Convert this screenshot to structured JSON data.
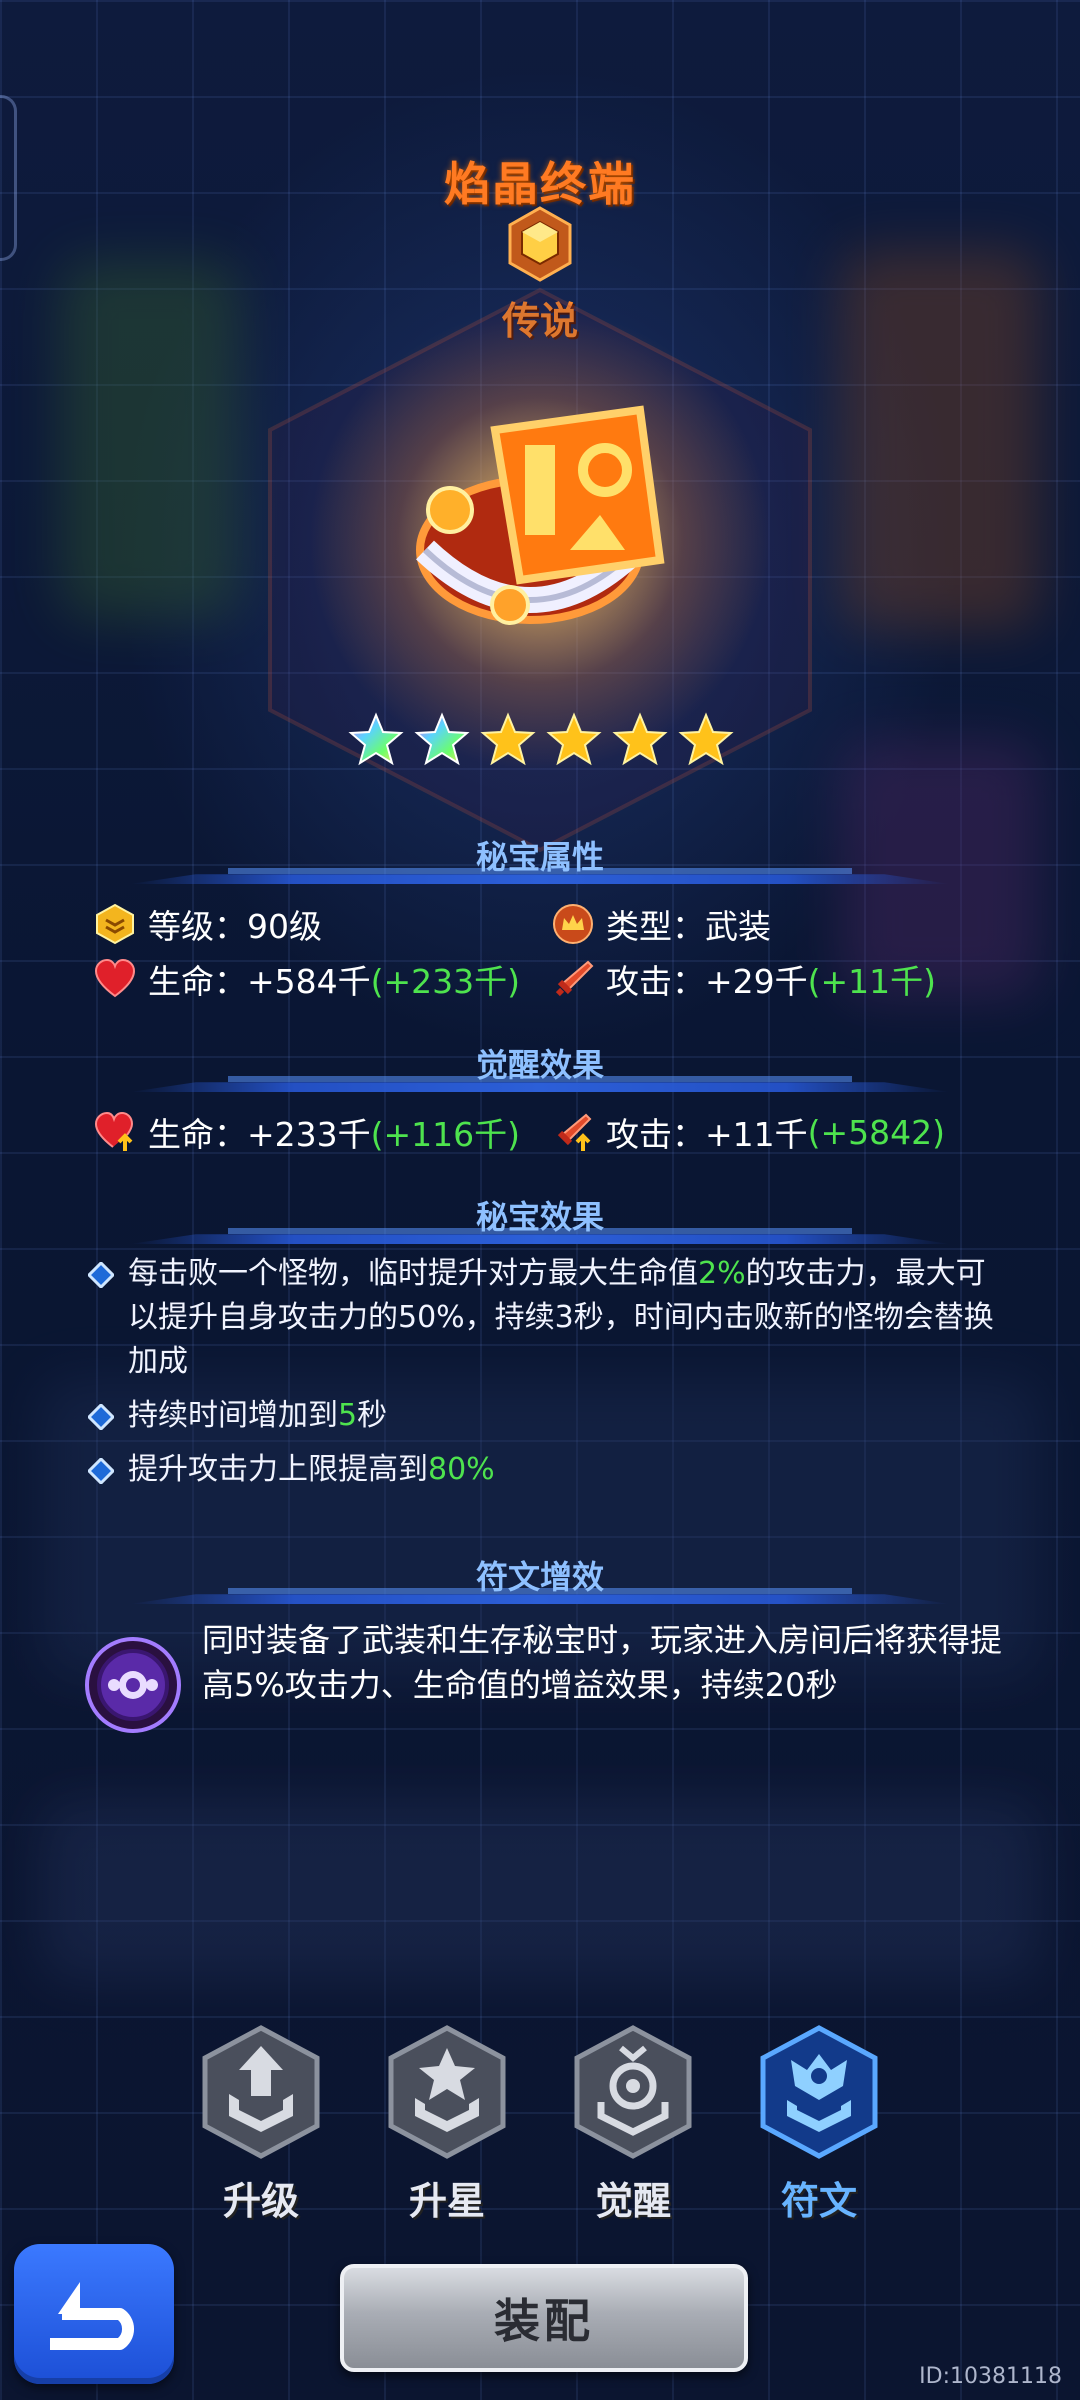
{
  "item": {
    "name": "焰晶终端",
    "rarity": "传说",
    "stars": {
      "total": 6,
      "rainbow": 2,
      "gold": 4
    }
  },
  "sections": {
    "properties": {
      "title": "秘宝属性",
      "level": {
        "label": "等级：",
        "value": "90级"
      },
      "type": {
        "label": "类型：",
        "value": "武装"
      },
      "hp": {
        "label": "生命：",
        "value": "+584千",
        "bonus": "(+233千)"
      },
      "atk": {
        "label": "攻击：",
        "value": "+29千",
        "bonus": "(+11千)"
      }
    },
    "awaken": {
      "title": "觉醒效果",
      "hp": {
        "label": "生命：",
        "value": "+233千",
        "bonus": "(+116千)"
      },
      "atk": {
        "label": "攻击：",
        "value": "+11千",
        "bonus": "(+5842)"
      }
    },
    "effect": {
      "title": "秘宝效果",
      "items": [
        {
          "pre": "每击败一个怪物，临时提升对方最大生命值",
          "hi": "2%",
          "post": "的攻击力，最大可以提升自身攻击力的50%，持续3秒，时间内击败新的怪物会替换加成"
        },
        {
          "pre": "持续时间增加到",
          "hi": "5",
          "post": "秒"
        },
        {
          "pre": "提升攻击力上限提高到",
          "hi": "80%",
          "post": ""
        }
      ]
    },
    "rune": {
      "title": "符文增效",
      "text": "同时装备了武装和生存秘宝时，玩家进入房间后将获得提高5%攻击力、生命值的增益效果，持续20秒"
    }
  },
  "tabs": [
    {
      "label": "升级",
      "icon": "upgrade-icon",
      "active": false
    },
    {
      "label": "升星",
      "icon": "star-up-icon",
      "active": false
    },
    {
      "label": "觉醒",
      "icon": "awaken-icon",
      "active": false
    },
    {
      "label": "符文",
      "icon": "rune-icon",
      "active": true
    }
  ],
  "buttons": {
    "equip": "装配",
    "back": "back-arrow-icon"
  },
  "uid": "ID:10381118",
  "colors": {
    "accent_orange": "#ff7a22",
    "highlight_green": "#4ee34e",
    "section_blue": "#8ec0ff",
    "active_tab": "#68b4ff"
  }
}
